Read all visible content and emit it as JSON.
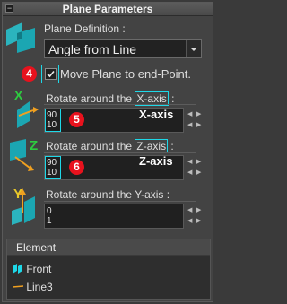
{
  "panel": {
    "title": "Plane Parameters",
    "collapse_glyph": "−"
  },
  "plane_definition": {
    "label": "Plane Definition :",
    "selected_value": "Angle from Line"
  },
  "move_plane": {
    "label": "Move Plane to end-Point.",
    "checked": true
  },
  "annotations": {
    "badge_4": "4",
    "badge_5": "5",
    "badge_6": "6"
  },
  "axes": [
    {
      "prefix": "Rotate around the ",
      "axis_text": "X-axis",
      "suffix": ":",
      "caption": "X-axis",
      "icon_letter": "X",
      "values": [
        "90",
        "10"
      ]
    },
    {
      "prefix": "Rotate around the ",
      "axis_text": "Z-axis",
      "suffix": ":",
      "caption": "Z-axis",
      "icon_letter": "Z",
      "values": [
        "90",
        "10"
      ]
    },
    {
      "prefix": "Rotate around the Y-axis :",
      "icon_letter": "Y",
      "values": [
        "0",
        "1"
      ]
    }
  ],
  "spinner_glyphs": {
    "up": "▲",
    "down": "▼",
    "left": "◀",
    "right": "▶"
  },
  "elements": {
    "header": "Element",
    "items": [
      {
        "label": "Front",
        "icon": "plane-icon"
      },
      {
        "label": "Line3",
        "icon": "line-icon"
      }
    ]
  },
  "colors": {
    "panel_bg": "#434343",
    "highlight": "#1ed8e8",
    "badge": "#e8121d",
    "axis_x": "#2ecc40",
    "axis_z": "#2ecc40",
    "axis_y": "#e8c82a",
    "arrow": "#f0a020"
  }
}
